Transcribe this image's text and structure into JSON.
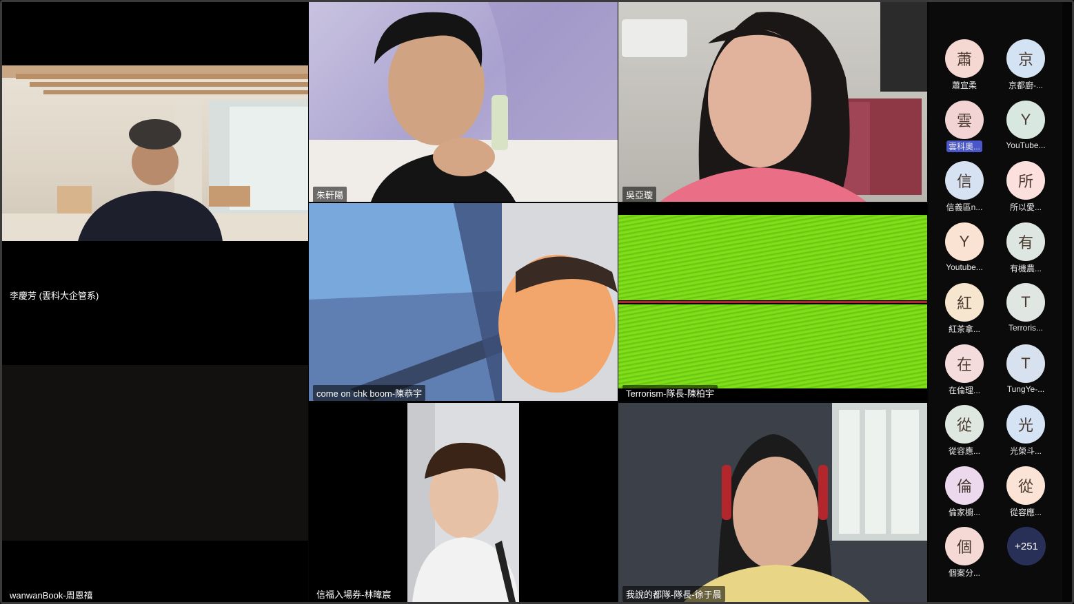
{
  "participants": [
    {
      "name": "李慶芳 (雲科大企管系)"
    },
    {
      "name": "wanwanBook-周恩禧"
    },
    {
      "name": "朱軒陽"
    },
    {
      "name": "吳亞璇"
    },
    {
      "name": "come on chk boom-陳恭宇"
    },
    {
      "name": "Terrorism-隊長-陳柏宇"
    },
    {
      "name": "信福入場券-林暐宸"
    },
    {
      "name": "我說的都隊-隊長-徐于晨"
    }
  ],
  "roster": [
    {
      "initial": "蕭",
      "label": "蕭宜柔",
      "color": "#f6d8d2"
    },
    {
      "initial": "京",
      "label": "京都廚-...",
      "color": "#d3e3f3"
    },
    {
      "initial": "雲",
      "label": "雲科奧...",
      "color": "#f2d4d4",
      "highlight": true
    },
    {
      "initial": "Y",
      "label": "YouTube...",
      "color": "#d8e8e0"
    },
    {
      "initial": "信",
      "label": "信義區n...",
      "color": "#d6e2f2"
    },
    {
      "initial": "所",
      "label": "所以愛...",
      "color": "#fbe0de"
    },
    {
      "initial": "Y",
      "label": "Youtube...",
      "color": "#fbe3d3"
    },
    {
      "initial": "有",
      "label": "有機農...",
      "color": "#dde6e0"
    },
    {
      "initial": "紅",
      "label": "紅茶拿...",
      "color": "#f7e6cf"
    },
    {
      "initial": "T",
      "label": "Terroris...",
      "color": "#e0e6e2"
    },
    {
      "initial": "在",
      "label": "在倫理...",
      "color": "#f4dbdc"
    },
    {
      "initial": "T",
      "label": "TungYe-...",
      "color": "#d8e2ef"
    },
    {
      "initial": "從",
      "label": "從容應...",
      "color": "#dfe8e0"
    },
    {
      "initial": "光",
      "label": "光榮斗...",
      "color": "#d6e3f4"
    },
    {
      "initial": "倫",
      "label": "倫家櫥...",
      "color": "#ecd9ee"
    },
    {
      "initial": "從",
      "label": "從容應...",
      "color": "#fbe3d5"
    },
    {
      "initial": "個",
      "label": "個案分...",
      "color": "#f5d9d5"
    }
  ],
  "more_participants": "+251"
}
